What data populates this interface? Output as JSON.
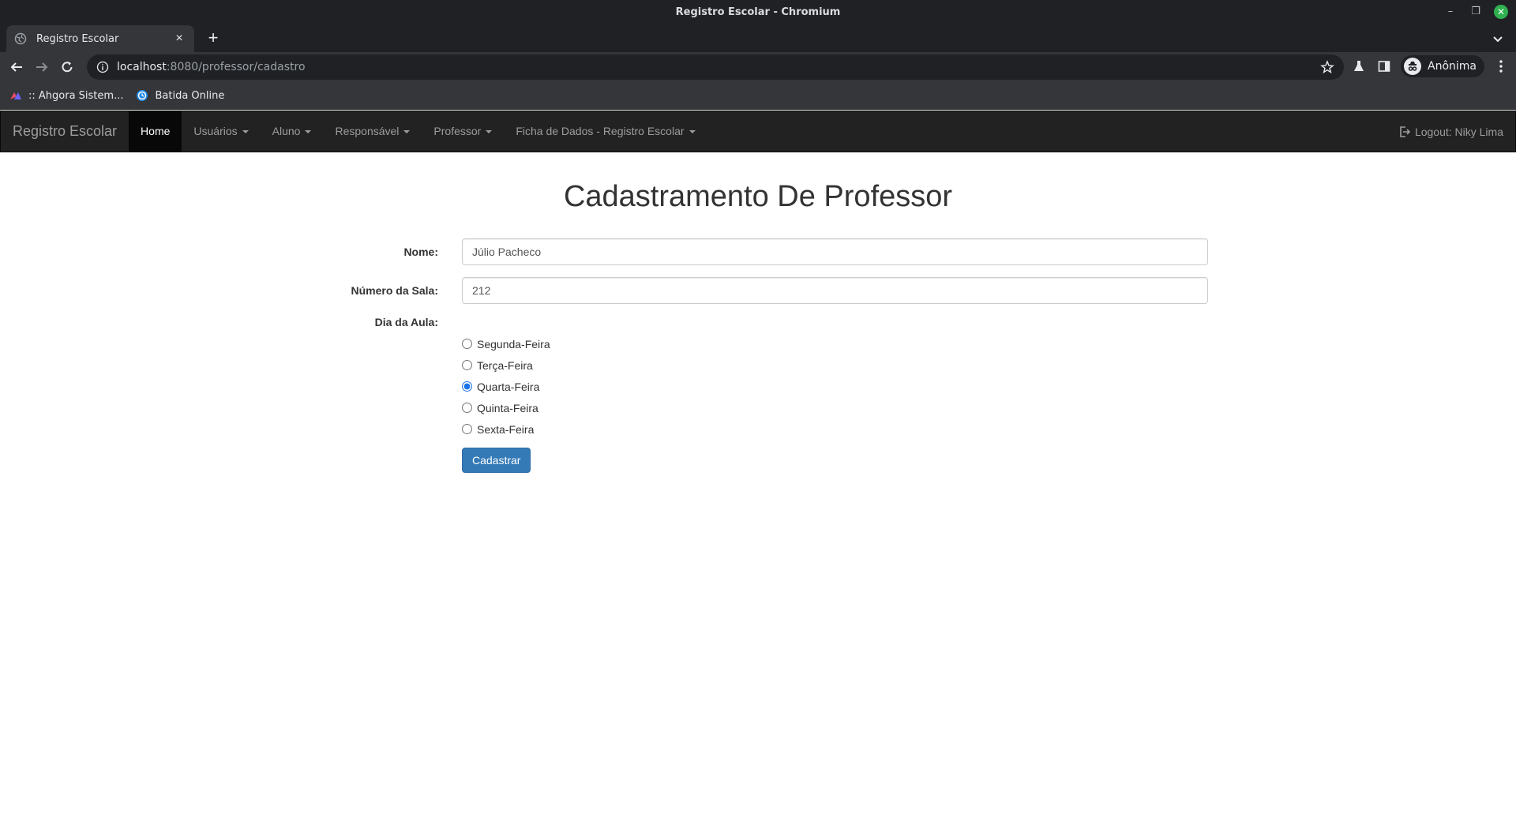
{
  "window": {
    "title": "Registro Escolar - Chromium"
  },
  "tab": {
    "title": "Registro Escolar"
  },
  "omnibox": {
    "host": "localhost",
    "path": ":8080/professor/cadastro"
  },
  "profile": {
    "name": "Anônima"
  },
  "bookmarks": [
    {
      "label": ":: Ahgora Sistem..."
    },
    {
      "label": "Batida Online"
    }
  ],
  "navbar": {
    "brand": "Registro Escolar",
    "items": [
      {
        "label": "Home"
      },
      {
        "label": "Usuários"
      },
      {
        "label": "Aluno"
      },
      {
        "label": "Responsável"
      },
      {
        "label": "Professor"
      },
      {
        "label": "Ficha de Dados - Registro Escolar"
      }
    ],
    "logout": "Logout: Niky Lima"
  },
  "form": {
    "title": "Cadastramento De Professor",
    "nome_label": "Nome:",
    "nome_value": "Júlio Pacheco",
    "sala_label": "Número da Sala:",
    "sala_value": "212",
    "dia_label": "Dia da Aula:",
    "dias": [
      {
        "label": "Segunda-Feira",
        "checked": false
      },
      {
        "label": "Terça-Feira",
        "checked": false
      },
      {
        "label": "Quarta-Feira",
        "checked": true
      },
      {
        "label": "Quinta-Feira",
        "checked": false
      },
      {
        "label": "Sexta-Feira",
        "checked": false
      }
    ],
    "submit_label": "Cadastrar"
  },
  "colors": {
    "navbar_bg": "#222222",
    "primary": "#337ab7",
    "window_close": "#2fb150"
  }
}
